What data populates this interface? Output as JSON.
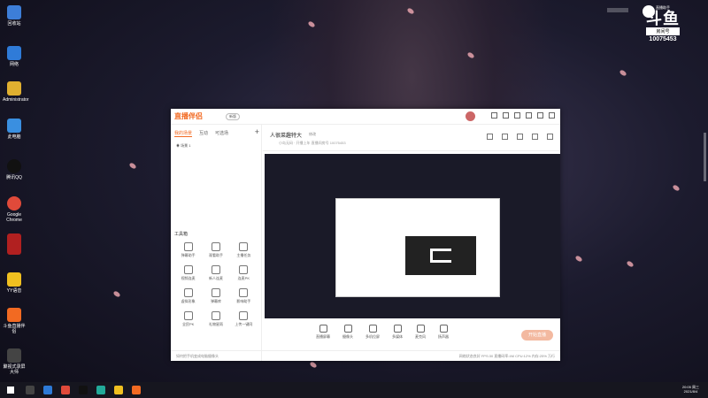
{
  "desktop": {
    "icons": [
      {
        "label": "回收站",
        "color": "#3d7ed8"
      },
      {
        "label": "网络",
        "color": "#2f7bd8"
      },
      {
        "label": "Administrator",
        "color": "#e0b030"
      },
      {
        "label": "此电脑",
        "color": "#3a8fe0"
      },
      {
        "label": "腾讯QQ",
        "color": "#111111"
      },
      {
        "label": "Google Chrome",
        "color": "#e04a3a"
      },
      {
        "label": "",
        "color": "#b12020"
      },
      {
        "label": "YY语音",
        "color": "#f0c020"
      },
      {
        "label": "斗鱼直播伴侣",
        "color": "#f26a22"
      },
      {
        "label": "聚视式录屏大师",
        "color": "#444444"
      }
    ]
  },
  "brand": {
    "small": "直播助手",
    "big": "斗鱼",
    "tag": "房间号",
    "room": "10075453"
  },
  "app": {
    "logo": "直播伴侣",
    "version": "新版",
    "tabs": [
      "我的场景",
      "互动",
      "可选场"
    ],
    "scene": "场景 1",
    "toolbox_title": "工具箱",
    "tools": [
      "弹幕助手",
      "观看助手",
      "主播任务",
      "视频连麦",
      "新人连麦",
      "连麦PK",
      "虚拟形象",
      "弹幕库",
      "影响助手",
      "全民PK",
      "礼物星雨",
      "上传一键同"
    ],
    "room_title": "人很菜趣特大",
    "room_edit": "修改",
    "room_sub": "小岛无码 · 开播上年   直播间房号 10075453",
    "bottom": [
      "直播屏幕",
      "摄像头",
      "多机位屏",
      "多媒体",
      "麦克风",
      "扬声器"
    ],
    "go_live": "开始直播",
    "status_left": "如何把手机变成电脑摄像头",
    "status_right": "网络状态良好  FPS:30  直播码率:4M  CPU:12%  内存:25%  万行"
  },
  "taskbar": {
    "time": "20:05 周三",
    "date": "2021/8/4"
  }
}
